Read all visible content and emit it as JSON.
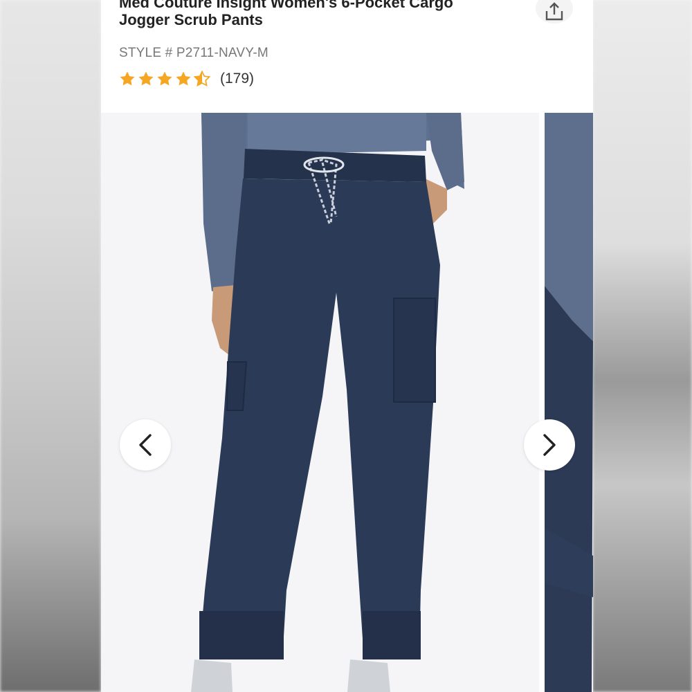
{
  "product": {
    "title_line1": "Med Couture Insight Women's 6-Pocket Cargo",
    "title_line2": "Jogger Scrub Pants",
    "style_number": "STYLE # P2711-NAVY-M",
    "rating": 4.5,
    "review_count": "(179)"
  },
  "colors": {
    "star": "#f5a623",
    "pants": "#2c3a55",
    "shirt": "#5d6f8c"
  },
  "icons": {
    "share": "share-icon",
    "prev": "chevron-left-icon",
    "next": "chevron-right-icon"
  }
}
